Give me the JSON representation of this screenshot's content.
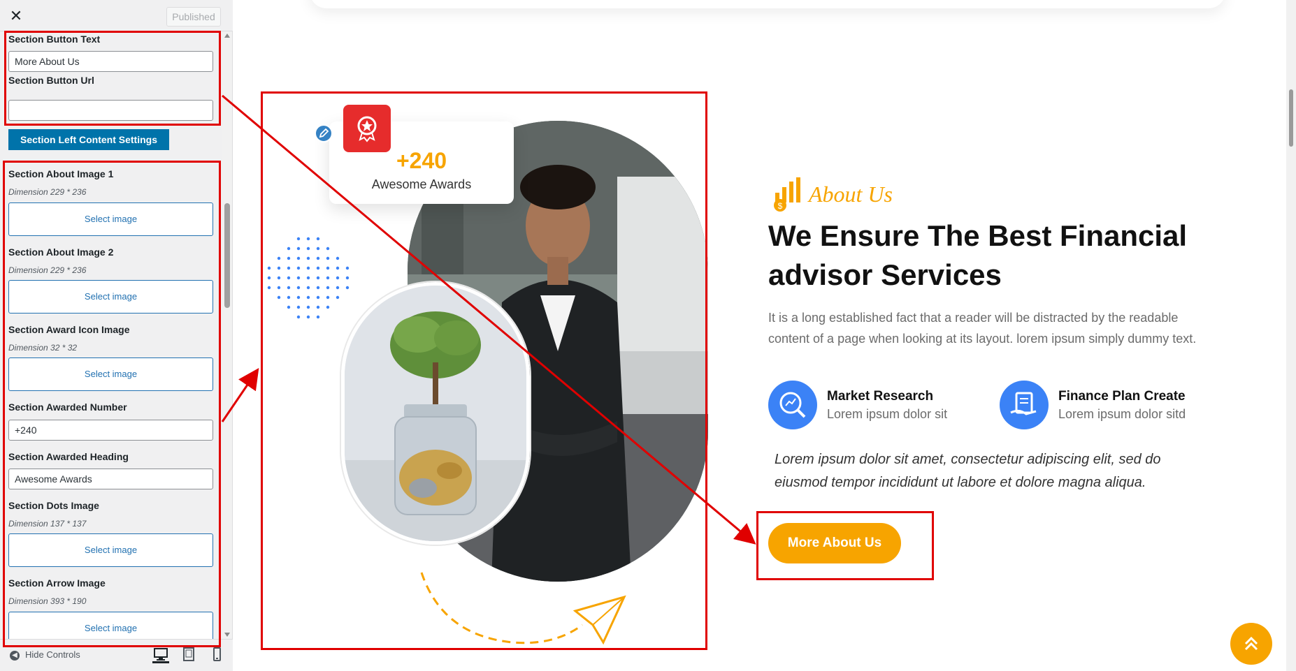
{
  "customizer": {
    "close_icon": "close-icon",
    "publish_label": "Published",
    "fields": {
      "button_text_label": "Section Button Text",
      "button_text_value": "More About Us",
      "button_url_label": "Section Button Url",
      "button_url_value": "",
      "left_settings_button": "Section Left Content Settings",
      "about_image1_label": "Section About Image 1",
      "about_image1_dim": "Dimension 229 * 236",
      "about_image2_label": "Section About Image 2",
      "about_image2_dim": "Dimension 229 * 236",
      "award_icon_label": "Section Award Icon Image",
      "award_icon_dim": "Dimension 32 * 32",
      "awarded_number_label": "Section Awarded Number",
      "awarded_number_value": "+240",
      "awarded_heading_label": "Section Awarded Heading",
      "awarded_heading_value": "Awesome Awards",
      "dots_label": "Section Dots Image",
      "dots_dim": "Dimension 137 * 137",
      "arrow_label": "Section Arrow Image",
      "arrow_dim": "Dimension 393 * 190",
      "select_image": "Select image"
    },
    "footer": {
      "hide_controls": "Hide Controls",
      "devices": [
        "desktop-icon",
        "tablet-icon",
        "mobile-icon"
      ]
    }
  },
  "preview": {
    "award": {
      "number": "+240",
      "heading": "Awesome Awards"
    },
    "about_label": "About Us",
    "heading": "We Ensure The Best Financial advisor Services",
    "description": "It is a long established fact that a reader will be distracted by the readable content of a page when looking at its layout. lorem ipsum simply dummy text.",
    "features": [
      {
        "title": "Market Research",
        "sub": "Lorem ipsum dolor sit",
        "icon": "magnifier-chart-icon"
      },
      {
        "title": "Finance Plan Create",
        "sub": "Lorem ipsum dolor sitd",
        "icon": "finance-plan-icon"
      }
    ],
    "quote": "Lorem ipsum dolor sit amet, consectetur adipiscing elit, sed do eiusmod tempor incididunt ut labore et dolore magna aliqua.",
    "button": "More About Us"
  },
  "colors": {
    "accent": "#f7a400",
    "wp_blue": "#0073aa",
    "annotation_red": "#e00000",
    "feature_blue": "#3b82f6",
    "award_red": "#e62c2c"
  }
}
